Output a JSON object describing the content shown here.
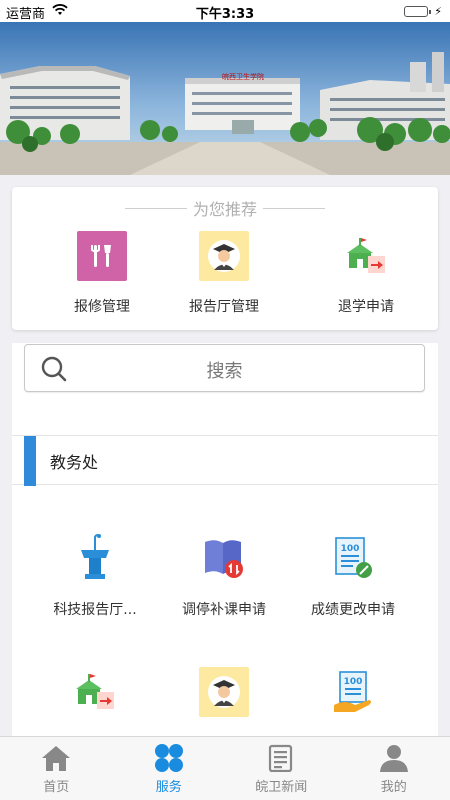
{
  "status_bar": {
    "carrier": "运营商",
    "time": "下午3:33",
    "battery_level": 1.0
  },
  "banner": {
    "sign_text": "皖西卫生学院"
  },
  "recommend": {
    "title": "为您推荐",
    "items": [
      {
        "label": "报修管理",
        "icon": "repair-tools-icon",
        "color": "#d063a8"
      },
      {
        "label": "报告厅管理",
        "icon": "graduate-avatar-icon",
        "color": "#fde9a0"
      },
      {
        "label": "退学申请",
        "icon": "school-exit-icon",
        "color": "#4caf50"
      }
    ]
  },
  "search": {
    "placeholder": "搜索"
  },
  "section": {
    "title": "教务处",
    "accent": "#2f8bd9",
    "items": [
      {
        "label": "科技报告厅...",
        "icon": "podium-icon"
      },
      {
        "label": "调停补课申请",
        "icon": "book-swap-icon"
      },
      {
        "label": "成绩更改申请",
        "icon": "score-edit-icon"
      },
      {
        "label": "",
        "icon": "school-exit-icon"
      },
      {
        "label": "",
        "icon": "graduate-avatar-icon"
      },
      {
        "label": "",
        "icon": "score-hand-icon"
      }
    ]
  },
  "tabs": [
    {
      "label": "首页",
      "icon": "home-icon"
    },
    {
      "label": "服务",
      "icon": "service-grid-icon",
      "active": true
    },
    {
      "label": "皖卫新闻",
      "icon": "news-icon"
    },
    {
      "label": "我的",
      "icon": "profile-icon"
    }
  ],
  "colors": {
    "active_tab": "#1a8cdf",
    "inactive_tab": "#888888"
  }
}
